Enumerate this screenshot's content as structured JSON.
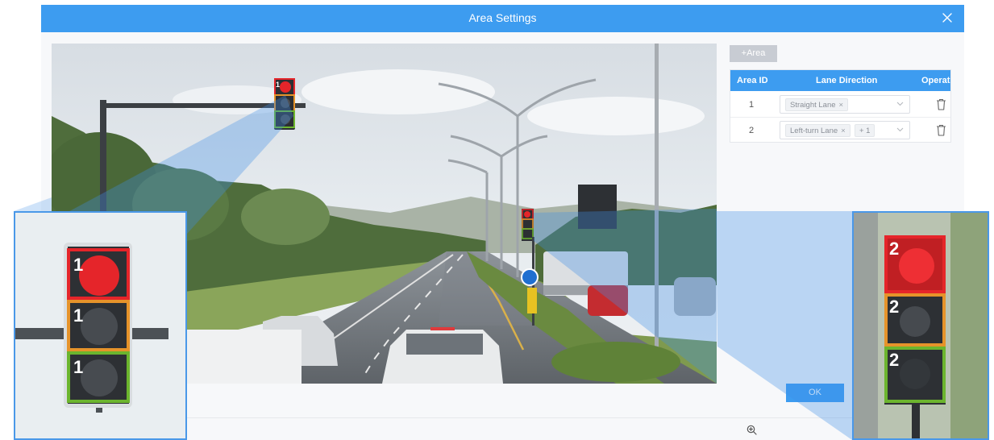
{
  "dialog": {
    "title": "Area Settings"
  },
  "toolbar": {
    "add_area_label": "+Area",
    "ok_label": "OK"
  },
  "table": {
    "headers": [
      "Area ID",
      "Lane Direction",
      "Operati"
    ],
    "rows": [
      {
        "id": "1",
        "tags": [
          "Straight Lane"
        ],
        "extra": ""
      },
      {
        "id": "2",
        "tags": [
          "Left-turn Lane"
        ],
        "extra": "+ 1"
      }
    ]
  },
  "scene": {
    "lamp_label_left": "1",
    "lamp_label_right": "2"
  },
  "zoom_left": {
    "labels": [
      "1",
      "1",
      "1"
    ]
  },
  "zoom_right": {
    "labels": [
      "2",
      "2",
      "2"
    ]
  },
  "icons": {
    "close": "close-icon",
    "zoom": "zoom-in-icon",
    "delete": "trash-icon",
    "dropdown": "chevron-down-icon"
  },
  "colors": {
    "primary": "#3d9cf0",
    "header_text": "#ffffff",
    "button_disabled": "#c8ccd3",
    "red_lamp": "#e5252a",
    "amber_frame": "#e6932a",
    "green_frame": "#6cb52e"
  }
}
